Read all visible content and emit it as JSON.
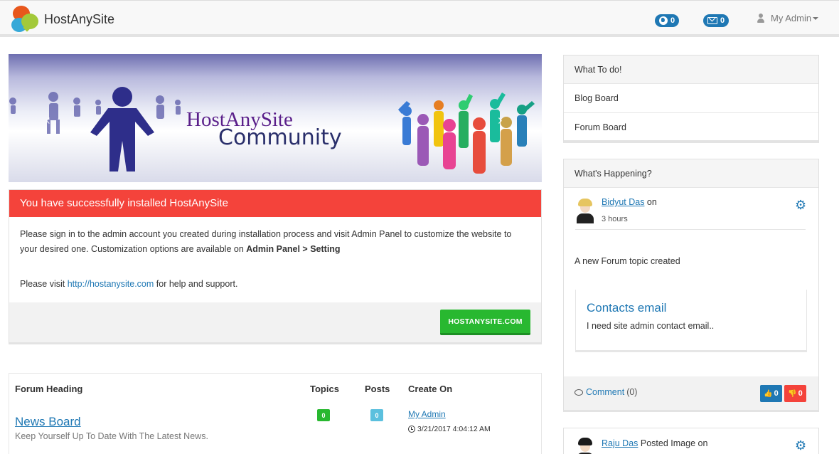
{
  "navbar": {
    "brand": "HostAnySite",
    "globe_count": "0",
    "message_count": "0",
    "user_label": "My Admin",
    "colors": {
      "badge": "#1f78b4",
      "bar": "#f8f8f8"
    }
  },
  "banner": {
    "title_line1": "HostAnySite",
    "title_line2": "Community",
    "prev_arrow": "‹",
    "next_arrow": "›"
  },
  "alert": {
    "heading": "You have successfully installed HostAnySite",
    "body_text": "Please sign in to the admin account you created during installation process and visit Admin Panel to customize the website to your desired one. Customization options are available on ",
    "body_bold": "Admin Panel > Setting",
    "visit_prefix": "Please visit ",
    "visit_link": "http://hostanysite.com",
    "visit_suffix": " for help and support.",
    "button_label": "HOSTANYSITE.COM",
    "colors": {
      "header": "#f4433b",
      "button": "#28b830"
    }
  },
  "forum": {
    "headers": {
      "heading": "Forum Heading",
      "topics": "Topics",
      "posts": "Posts",
      "created": "Create On"
    },
    "rows": [
      {
        "title": "News Board",
        "description": "Keep Yourself Up To Date With The Latest News.",
        "topics": "0",
        "posts": "0",
        "creator": "My Admin",
        "created_on": "3/21/2017 4:04:12 AM"
      }
    ]
  },
  "todo": {
    "heading": "What To do!",
    "items": [
      "Blog Board",
      "Forum Board"
    ]
  },
  "happening": {
    "heading": "What's Happening?",
    "posts": [
      {
        "user": "Bidyut Das",
        "action": " on",
        "time": "3 hours",
        "text": "A new Forum topic created",
        "topic_title": "Contacts email",
        "topic_desc": "I need site admin contact email..",
        "comment_label": "Comment",
        "comment_count": "(0)",
        "likes": "0",
        "dislikes": "0"
      },
      {
        "user": "Raju Das",
        "action": " Posted Image on"
      }
    ]
  },
  "icons": [
    "globe-icon",
    "envelope-icon",
    "user-icon",
    "caret-down-icon",
    "gear-icon",
    "clock-icon",
    "comment-icon",
    "thumbs-up-icon",
    "thumbs-down-icon"
  ]
}
